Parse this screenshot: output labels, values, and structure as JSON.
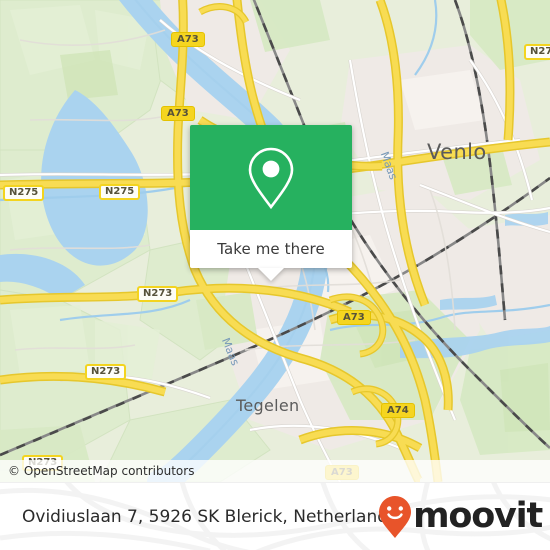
{
  "map": {
    "attribution": "© OpenStreetMap contributors",
    "city_labels": [
      {
        "name": "Venlo"
      },
      {
        "name": "Tegelen"
      }
    ],
    "river_labels": [
      {
        "name": "Maas"
      },
      {
        "name": "Maas"
      }
    ],
    "road_shields": [
      {
        "ref": "A73",
        "type": "motorway"
      },
      {
        "ref": "A73",
        "type": "motorway"
      },
      {
        "ref": "A73",
        "type": "motorway"
      },
      {
        "ref": "A73",
        "type": "motorway"
      },
      {
        "ref": "A74",
        "type": "motorway"
      },
      {
        "ref": "N275",
        "type": "trunk"
      },
      {
        "ref": "N275",
        "type": "trunk"
      },
      {
        "ref": "N273",
        "type": "trunk"
      },
      {
        "ref": "N273",
        "type": "trunk"
      },
      {
        "ref": "N273",
        "type": "trunk"
      },
      {
        "ref": "N27",
        "type": "trunk"
      }
    ],
    "colors": {
      "land": "#e9eedd",
      "farmland": "#deebcd",
      "urban": "#efeae6",
      "water": "#aad3ef",
      "motorway": "#f7d94e",
      "motorway_casing": "#e8c32c",
      "road": "#ffffff",
      "rail": "#6b6b6b",
      "label": "#5b5b5b"
    }
  },
  "popup_card": {
    "icon": "map-pin-icon",
    "button_label": "Take me there",
    "accent_color": "#26b15f"
  },
  "footer": {
    "address": "Ovidiuslaan 7, 5926 SK Blerick, Netherlands",
    "brand_name": "moovit",
    "brand_icon": "moovit-pin-smiley-icon",
    "brand_color": "#e8542a",
    "brand_text_color": "#222222"
  }
}
